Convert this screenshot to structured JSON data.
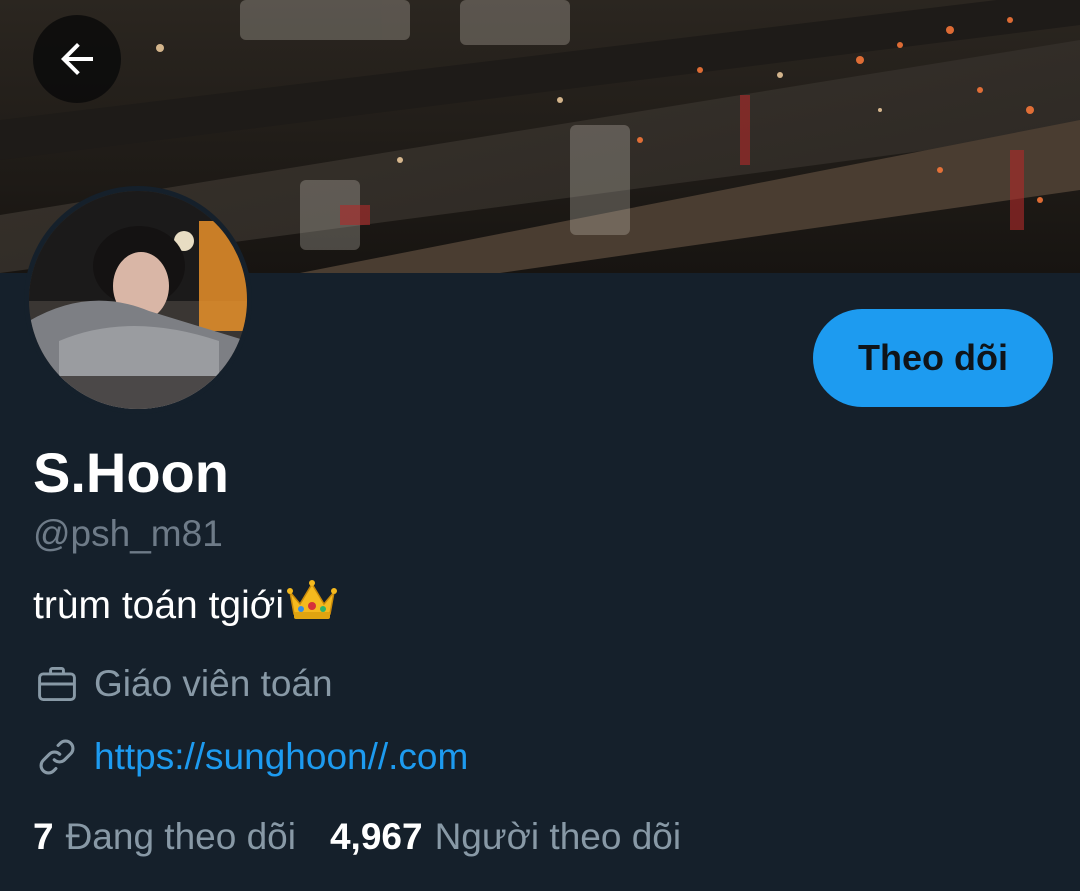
{
  "profile": {
    "display_name": "S.Hoon",
    "handle": "@psh_m81",
    "bio": "trùm toán tgiới",
    "bio_emoji": "crown-emoji",
    "job": "Giáo viên toán",
    "website": "https://sunghoon//.com"
  },
  "actions": {
    "follow_label": "Theo dõi"
  },
  "stats": {
    "following_count": "7",
    "following_label": "Đang theo dõi",
    "followers_count": "4,967",
    "followers_label": "Người theo dõi"
  },
  "icons": {
    "back": "arrow-left-icon",
    "job": "briefcase-icon",
    "link": "link-icon"
  },
  "colors": {
    "background": "#15202b",
    "accent": "#1d9bf0",
    "secondary_text": "#8899a6",
    "primary_text": "#ffffff"
  }
}
